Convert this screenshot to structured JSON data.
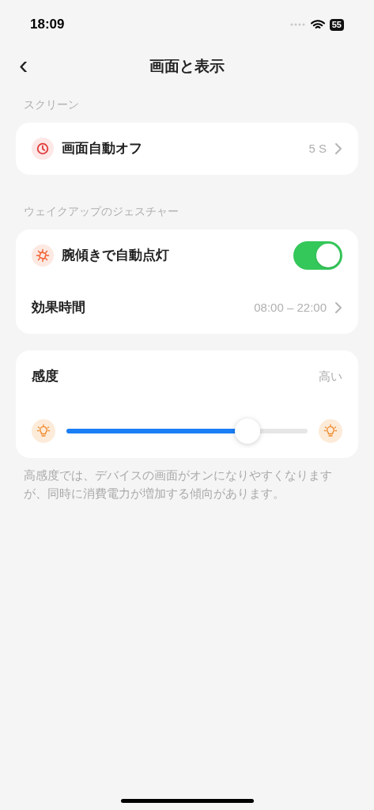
{
  "status_bar": {
    "time": "18:09",
    "battery": "55"
  },
  "nav": {
    "back": "‹",
    "title": "画面と表示"
  },
  "sections": [
    {
      "label": "スクリーン",
      "rows": [
        {
          "kind": "link",
          "label": "画面自動オフ",
          "value": "5 S"
        }
      ]
    },
    {
      "label": "ウェイクアップのジェスチャー",
      "rows": [
        {
          "kind": "toggle",
          "label": "腕傾きで自動点灯",
          "on": true
        },
        {
          "kind": "link",
          "label": "効果時間",
          "value": "08:00 – 22:00"
        }
      ]
    }
  ],
  "sensitivity": {
    "label": "感度",
    "value": "高い",
    "level": 0.75
  },
  "note": "高感度では、デバイスの画面がオンになりやすくなりますが、同時に消費電力が増加する傾向があります。"
}
